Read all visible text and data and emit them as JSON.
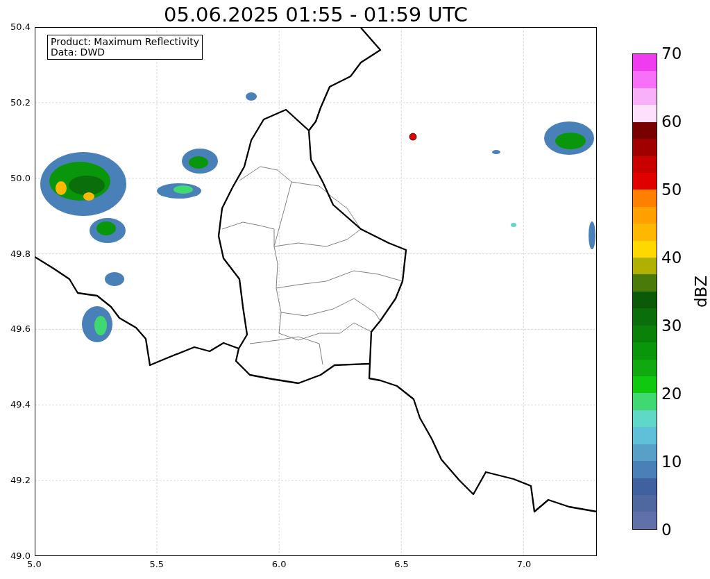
{
  "title": "05.06.2025 01:55 - 01:59 UTC",
  "map": {
    "annotation": [
      "Product: Maximum Reflectivity",
      "Data: DWD"
    ],
    "xticks": [
      "5.0",
      "5.5",
      "6.0",
      "6.5",
      "7.0"
    ],
    "yticks": [
      "50.4",
      "50.2",
      "50.0",
      "49.8",
      "49.6",
      "49.4",
      "49.2",
      "49.0"
    ]
  },
  "colorbar": {
    "label": "dBZ",
    "ticks": [
      "70",
      "60",
      "50",
      "40",
      "30",
      "20",
      "10",
      "0"
    ],
    "segments": [
      {
        "color": "#f03cf0"
      },
      {
        "color": "#f870f8"
      },
      {
        "color": "#f8b0f8"
      },
      {
        "color": "#fce0fc"
      },
      {
        "color": "#780000"
      },
      {
        "color": "#a00000"
      },
      {
        "color": "#c80000"
      },
      {
        "color": "#e00000"
      },
      {
        "color": "#ff8000"
      },
      {
        "color": "#ffa000"
      },
      {
        "color": "#ffb800"
      },
      {
        "color": "#ffd800"
      },
      {
        "color": "#b0b000"
      },
      {
        "color": "#4a7a0a"
      },
      {
        "color": "#0a5a0a"
      },
      {
        "color": "#0a6e0a"
      },
      {
        "color": "#0a820a"
      },
      {
        "color": "#0a960a"
      },
      {
        "color": "#10aa10"
      },
      {
        "color": "#10c810"
      },
      {
        "color": "#40d870"
      },
      {
        "color": "#60d8c8"
      },
      {
        "color": "#60c0d8"
      },
      {
        "color": "#58a0c8"
      },
      {
        "color": "#4a80b8"
      },
      {
        "color": "#4060a0"
      },
      {
        "color": "#5068a0"
      },
      {
        "color": "#6070a8"
      }
    ]
  }
}
